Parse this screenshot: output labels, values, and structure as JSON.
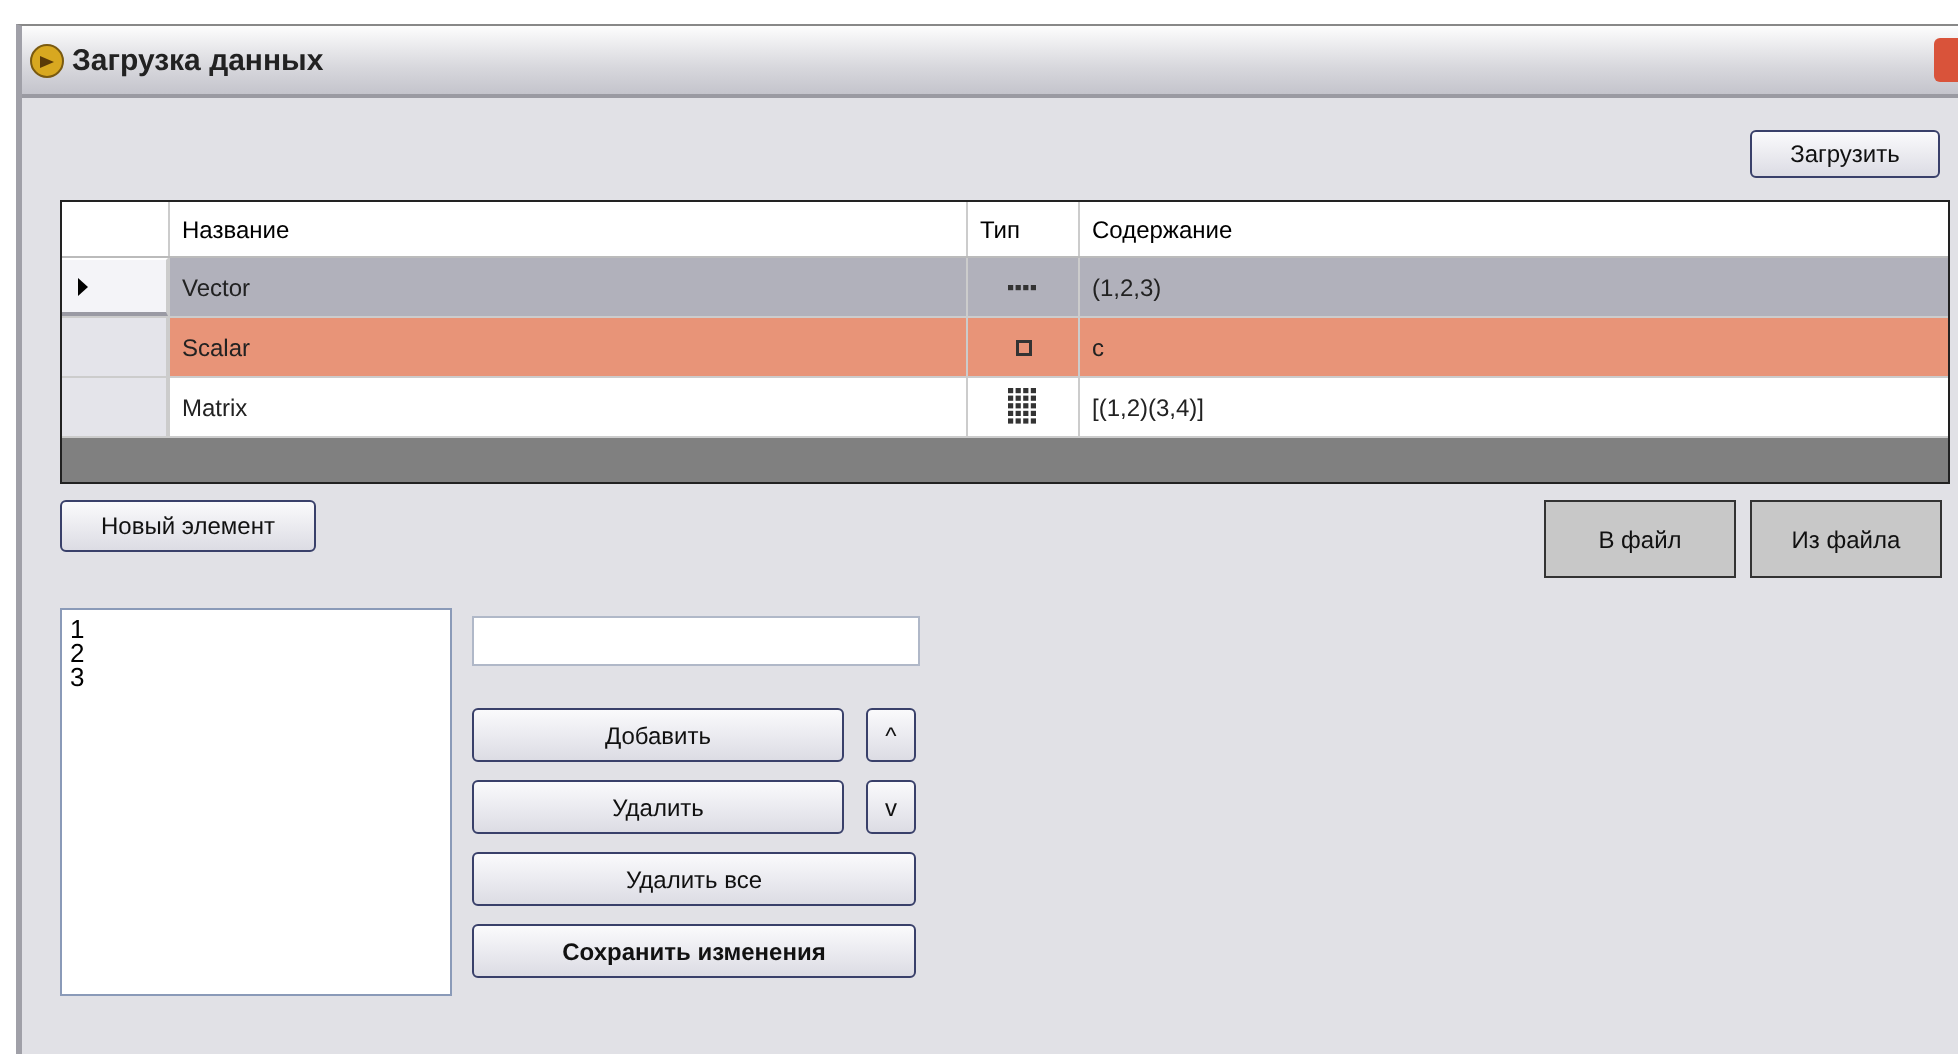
{
  "window": {
    "title": "Загрузка данных"
  },
  "load_button": "Загрузить",
  "table": {
    "columns": [
      "Название",
      "Тип",
      "Содержание"
    ],
    "rows": [
      {
        "name": "Vector",
        "kind": "vector",
        "content": "(1,2,3)",
        "selected": true,
        "color": "#b1b1bb"
      },
      {
        "name": "Scalar",
        "kind": "scalar",
        "content": "c",
        "selected": false,
        "color": "#e89478"
      },
      {
        "name": "Matrix",
        "kind": "matrix",
        "content": "[(1,2)(3,4)]",
        "selected": false,
        "color": "#ffffff"
      }
    ]
  },
  "new_element_button": "Новый элемент",
  "file_buttons": [
    "В файл",
    "Из файла"
  ],
  "list_items": [
    "1",
    "2",
    "3"
  ],
  "add_button": "Добавить",
  "up_button": "^",
  "delete_button": "Удалить",
  "down_button": "v",
  "delete_all_button": "Удалить все",
  "save_button": "Сохранить изменения"
}
